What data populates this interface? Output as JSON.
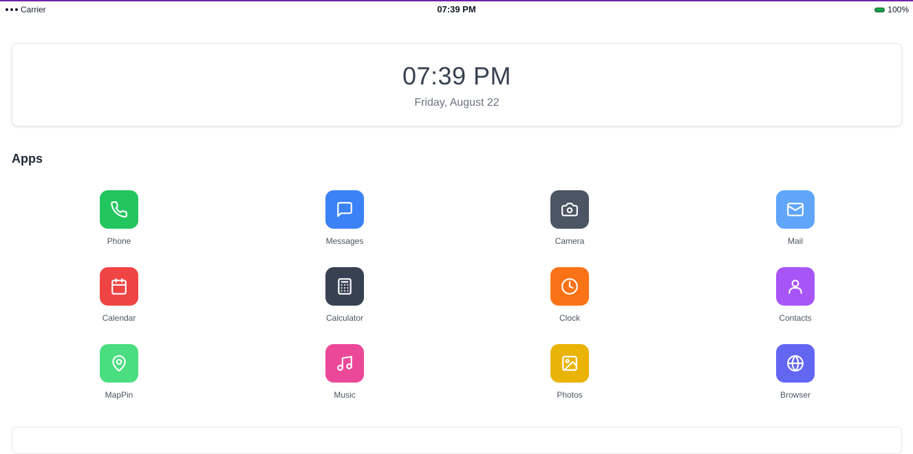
{
  "status_bar": {
    "carrier": "Carrier",
    "time": "07:39 PM",
    "battery": "100%"
  },
  "clock_widget": {
    "time": "07:39 PM",
    "date": "Friday, August 22"
  },
  "apps_section": {
    "title": "Apps",
    "apps": [
      {
        "label": "Phone",
        "icon": "phone-icon",
        "color": "#22c55e"
      },
      {
        "label": "Messages",
        "icon": "message-icon",
        "color": "#3b82f6"
      },
      {
        "label": "Camera",
        "icon": "camera-icon",
        "color": "#4b5563"
      },
      {
        "label": "Mail",
        "icon": "mail-icon",
        "color": "#60a5fa"
      },
      {
        "label": "Calendar",
        "icon": "calendar-icon",
        "color": "#ef4444"
      },
      {
        "label": "Calculator",
        "icon": "calculator-icon",
        "color": "#374151"
      },
      {
        "label": "Clock",
        "icon": "clock-icon",
        "color": "#f97316"
      },
      {
        "label": "Contacts",
        "icon": "user-icon",
        "color": "#a855f7"
      },
      {
        "label": "MapPin",
        "icon": "map-pin-icon",
        "color": "#4ade80"
      },
      {
        "label": "Music",
        "icon": "music-icon",
        "color": "#ec4899"
      },
      {
        "label": "Photos",
        "icon": "image-icon",
        "color": "#eab308"
      },
      {
        "label": "Browser",
        "icon": "globe-icon",
        "color": "#6366f1"
      }
    ]
  }
}
